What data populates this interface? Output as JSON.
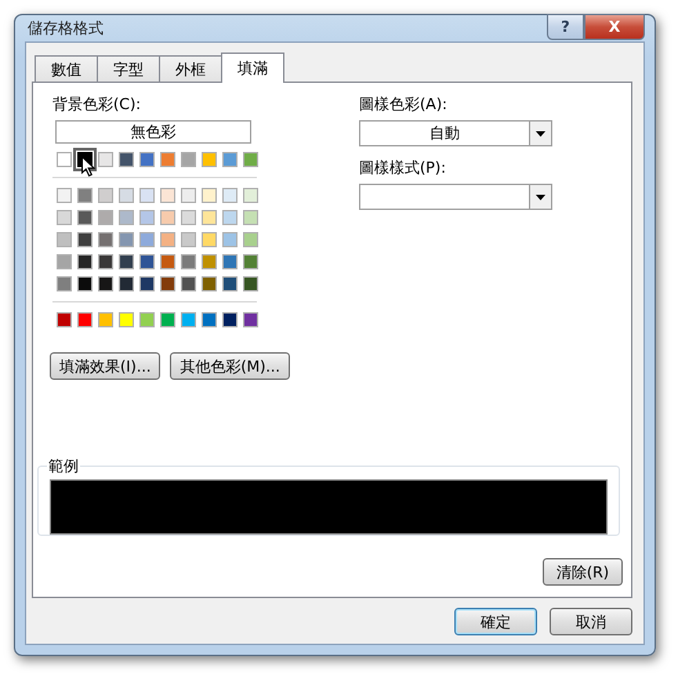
{
  "window": {
    "title": "儲存格格式",
    "help_button": "?",
    "close_button": "X"
  },
  "tabs": [
    {
      "label": "數值",
      "selected": false
    },
    {
      "label": "字型",
      "selected": false
    },
    {
      "label": "外框",
      "selected": false
    },
    {
      "label": "填滿",
      "selected": true
    }
  ],
  "background_color": {
    "label": "背景色彩(C):",
    "no_color_button": "無色彩",
    "theme_row": [
      {
        "color": "#ffffff",
        "selected": false
      },
      {
        "color": "#000000",
        "selected": true
      },
      {
        "color": "#e7e6e6",
        "selected": false
      },
      {
        "color": "#44546a",
        "selected": false
      },
      {
        "color": "#4472c4",
        "selected": false
      },
      {
        "color": "#ed7d31",
        "selected": false
      },
      {
        "color": "#a5a5a5",
        "selected": false
      },
      {
        "color": "#ffc000",
        "selected": false
      },
      {
        "color": "#5b9bd5",
        "selected": false
      },
      {
        "color": "#70ad47",
        "selected": false
      }
    ],
    "tint_rows": [
      [
        {
          "color": "#f2f2f2",
          "selected": false
        },
        {
          "color": "#808080",
          "selected": false
        },
        {
          "color": "#d0cece",
          "selected": false
        },
        {
          "color": "#d6dce4",
          "selected": false
        },
        {
          "color": "#d9e2f3",
          "selected": false
        },
        {
          "color": "#fbe5d5",
          "selected": false
        },
        {
          "color": "#ededed",
          "selected": false
        },
        {
          "color": "#fff2cc",
          "selected": false
        },
        {
          "color": "#deebf6",
          "selected": false
        },
        {
          "color": "#e2efd9",
          "selected": false
        }
      ],
      [
        {
          "color": "#d8d8d8",
          "selected": false
        },
        {
          "color": "#595959",
          "selected": false
        },
        {
          "color": "#aeabab",
          "selected": false
        },
        {
          "color": "#adb9ca",
          "selected": false
        },
        {
          "color": "#b4c6e7",
          "selected": false
        },
        {
          "color": "#f7cbac",
          "selected": false
        },
        {
          "color": "#dbdbdb",
          "selected": false
        },
        {
          "color": "#fee599",
          "selected": false
        },
        {
          "color": "#bdd7ee",
          "selected": false
        },
        {
          "color": "#c5e0b3",
          "selected": false
        }
      ],
      [
        {
          "color": "#bfbfbf",
          "selected": false
        },
        {
          "color": "#3f3f3f",
          "selected": false
        },
        {
          "color": "#757070",
          "selected": false
        },
        {
          "color": "#8496b0",
          "selected": false
        },
        {
          "color": "#8eaadb",
          "selected": false
        },
        {
          "color": "#f4b183",
          "selected": false
        },
        {
          "color": "#c9c9c9",
          "selected": false
        },
        {
          "color": "#ffd965",
          "selected": false
        },
        {
          "color": "#9dc3e6",
          "selected": false
        },
        {
          "color": "#a8d08d",
          "selected": false
        }
      ],
      [
        {
          "color": "#a5a5a5",
          "selected": false
        },
        {
          "color": "#262626",
          "selected": false
        },
        {
          "color": "#3a3838",
          "selected": false
        },
        {
          "color": "#323f4f",
          "selected": false
        },
        {
          "color": "#2f5496",
          "selected": false
        },
        {
          "color": "#c55a11",
          "selected": false
        },
        {
          "color": "#7b7b7b",
          "selected": false
        },
        {
          "color": "#bf9000",
          "selected": false
        },
        {
          "color": "#2e75b5",
          "selected": false
        },
        {
          "color": "#538135",
          "selected": false
        }
      ],
      [
        {
          "color": "#7f7f7f",
          "selected": false
        },
        {
          "color": "#0c0c0c",
          "selected": false
        },
        {
          "color": "#171616",
          "selected": false
        },
        {
          "color": "#222a35",
          "selected": false
        },
        {
          "color": "#1e3864",
          "selected": false
        },
        {
          "color": "#833c0b",
          "selected": false
        },
        {
          "color": "#525252",
          "selected": false
        },
        {
          "color": "#7f6000",
          "selected": false
        },
        {
          "color": "#1f4e79",
          "selected": false
        },
        {
          "color": "#375623",
          "selected": false
        }
      ]
    ],
    "standard_row": [
      {
        "color": "#c00000",
        "selected": false
      },
      {
        "color": "#ff0000",
        "selected": false
      },
      {
        "color": "#ffc000",
        "selected": false
      },
      {
        "color": "#ffff00",
        "selected": false
      },
      {
        "color": "#92d050",
        "selected": false
      },
      {
        "color": "#00b050",
        "selected": false
      },
      {
        "color": "#00b0f0",
        "selected": false
      },
      {
        "color": "#0070c0",
        "selected": false
      },
      {
        "color": "#002060",
        "selected": false
      },
      {
        "color": "#7030a0",
        "selected": false
      }
    ],
    "buttons": [
      "填滿效果(I)...",
      "其他色彩(M)..."
    ]
  },
  "pattern_color": {
    "label": "圖樣色彩(A):",
    "value": "自動"
  },
  "pattern_style": {
    "label": "圖樣樣式(P):"
  },
  "sample": {
    "label": "範例",
    "color": "#000000"
  },
  "clear_button": "清除(R)",
  "footer_buttons": [
    {
      "label": "確定",
      "default": true
    },
    {
      "label": "取消",
      "default": false
    }
  ]
}
